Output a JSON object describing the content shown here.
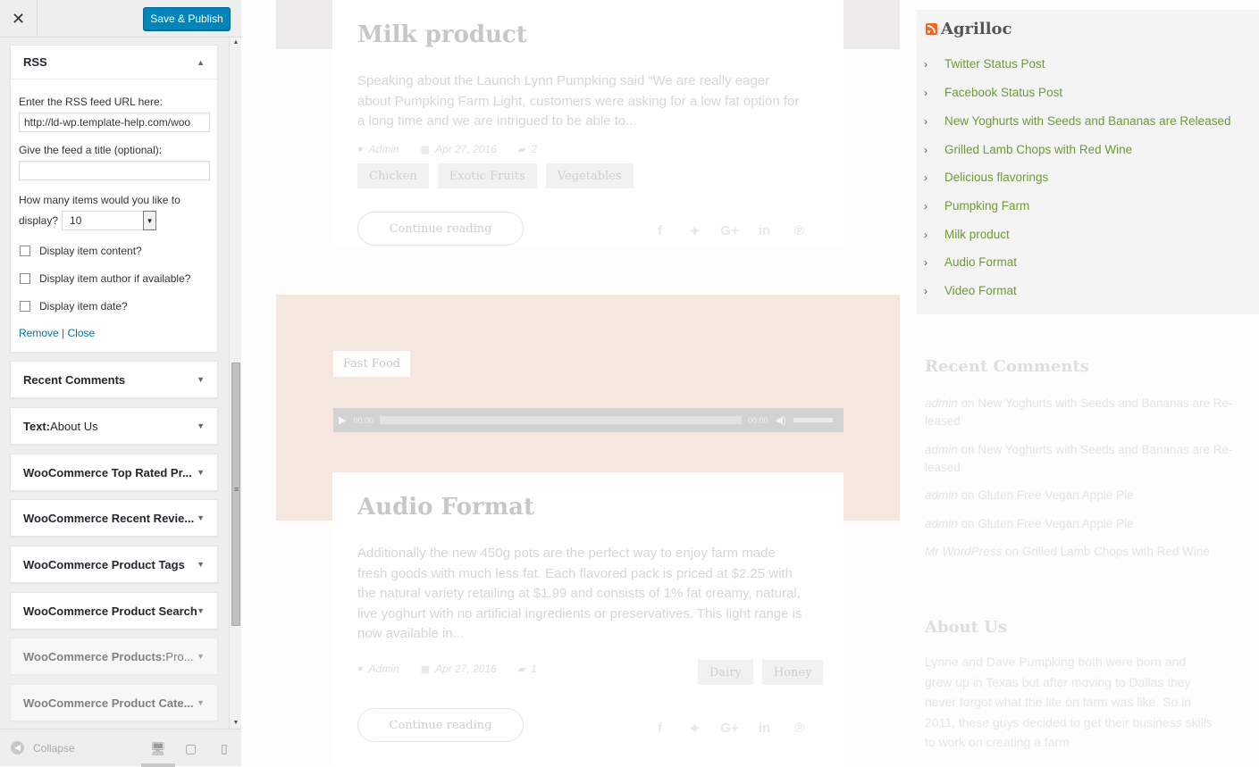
{
  "customizer": {
    "publish_label": "Save & Publish",
    "close_glyph": "✕",
    "rss_widget": {
      "title": "RSS",
      "url_label": "Enter the RSS feed URL here:",
      "url_value": "http://ld-wp.template-help.com/woo",
      "title_label": "Give the feed a title (optional):",
      "title_value": "",
      "items_label_1": "How many items would you like to",
      "items_label_2": "display?",
      "items_value": "10",
      "opt_content": "Display item content?",
      "opt_author": "Display item author if available?",
      "opt_date": "Display item date?",
      "remove_label": "Remove",
      "separator": "|",
      "close_label": "Close"
    },
    "widgets": [
      {
        "name": "Recent Comments",
        "rest": ""
      },
      {
        "name": "Text:",
        "rest": " About Us"
      },
      {
        "name": "WooCommerce Top Rated Pr...",
        "rest": ""
      },
      {
        "name": "WooCommerce Recent Revie...",
        "rest": ""
      },
      {
        "name": "WooCommerce Product Tags",
        "rest": ""
      },
      {
        "name": "WooCommerce Product Search",
        "rest": ""
      },
      {
        "name": "WooCommerce Products:",
        "rest": " Pro..."
      },
      {
        "name": "WooCommerce Product Cate...",
        "rest": ""
      }
    ],
    "collapse_label": "Collapse"
  },
  "preview": {
    "post1": {
      "title": "Milk product",
      "excerpt": "Speaking about the Launch Lynn Pumpking said “We are really eager about Pumpking Farm Light, customers were asking for a low fat option for a long time and we are intrigued to be able to...",
      "author": "Admin",
      "date": "Apr 27, 2016",
      "comments": "2",
      "tags": [
        "Chicken",
        "Exotic Fruits",
        "Vegetables"
      ],
      "continue_label": "Continue reading"
    },
    "audio": {
      "category": "Fast Food",
      "time_current": "00:00",
      "time_total": "00:00"
    },
    "post2": {
      "title": "Audio Format",
      "excerpt": "Additionally the new 450g pots are the perfect way to enjoy farm made fresh goods with much less fat. Each flavored pack is priced at $2.25 with the natural variety retailing at $1.99 and consists of 1% fat creamy, natural, live yoghurt with no artificial ingredients or preservatives. This light range is now available in...",
      "author": "Admin",
      "date": "Apr 27, 2016",
      "comments": "1",
      "tags": [
        "Dairy",
        "Honey"
      ],
      "continue_label": "Continue reading"
    },
    "rss_sidebar": {
      "title": "Agrilloc",
      "items": [
        "Twitter Status Post",
        "Facebook Status Post",
        "New Yoghurts with Seeds and Bananas are Released",
        "Grilled Lamb Chops with Red Wine",
        "Delicious flavorings",
        "Pumpking Farm",
        "Milk product",
        "Audio Format",
        "Video Format"
      ]
    },
    "recent_comments": {
      "title": "Recent Comments",
      "connector": "on",
      "items": [
        {
          "author": "admin",
          "post": "New Yoghurts with Seeds and Bananas are Re-leased"
        },
        {
          "author": "admin",
          "post": "New Yoghurts with Seeds and Bananas are Re-leased"
        },
        {
          "author": "admin",
          "post": "Gluten Free Vegan Apple Pie"
        },
        {
          "author": "admin",
          "post": "Gluten Free Vegan Apple Pie"
        },
        {
          "author": "Mr WordPress",
          "post": "Grilled Lamb Chops with Red Wine"
        }
      ]
    },
    "about": {
      "title": "About Us",
      "text": "Lynne and Dave Pumpking both were born and grew up in Texas but after moving to Dallas they never forgot what the life on farm was like. So in 2011, these guys decided to get their business skills to work on creating a farm"
    }
  },
  "colors": {
    "publish": "#0085ba",
    "link": "#0073aa",
    "rss_link_green": "#6f9a35",
    "audio_band": "#f5e7df",
    "rss_icon": "#f26522"
  }
}
